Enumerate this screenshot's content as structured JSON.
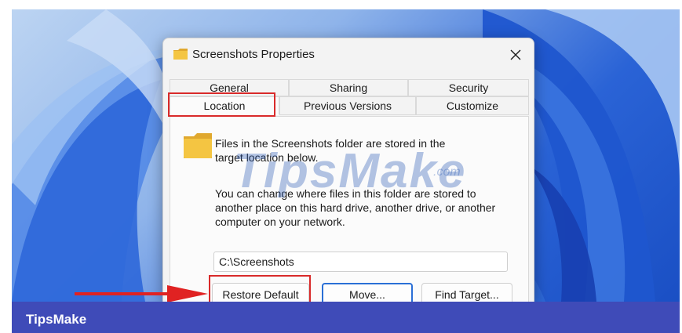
{
  "dialog": {
    "title": "Screenshots Properties",
    "close_label": "✕",
    "tabs_row1": [
      {
        "label": "General"
      },
      {
        "label": "Sharing"
      },
      {
        "label": "Security"
      }
    ],
    "tabs_row2": [
      {
        "label": "Location",
        "active": true
      },
      {
        "label": "Previous Versions"
      },
      {
        "label": "Customize"
      }
    ],
    "location_panel": {
      "info_text": "Files in the Screenshots folder are stored in the target location below.",
      "description": "You can change where files in this folder are stored to another place on this hard drive, another drive, or another computer on your network.",
      "path_value": "C:\\Screenshots",
      "buttons": {
        "restore_default": "Restore Default",
        "move": "Move...",
        "find_target": "Find Target..."
      }
    }
  },
  "watermark": {
    "text": "TipsMake",
    "suffix": ".com"
  },
  "footer": {
    "brand": "TipsMake"
  },
  "colors": {
    "highlight": "#d92a2a",
    "footer_bar": "#3f4bb8",
    "focus_border": "#2a6fd6",
    "folder_yellow": "#f4c542"
  },
  "icons": {
    "title_icon": "folder-icon",
    "panel_icon": "folder-icon",
    "close_icon": "close-icon",
    "annotation": "red-arrow"
  }
}
